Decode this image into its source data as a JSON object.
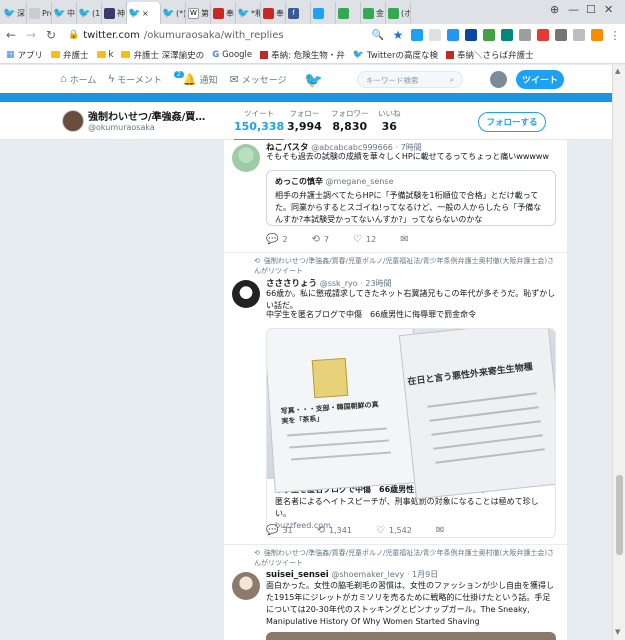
{
  "browser": {
    "tabs": [
      {
        "label": "深",
        "icon": "twitter-icon"
      },
      {
        "label": "Pro",
        "icon": "page-icon"
      },
      {
        "label": "中",
        "icon": "twitter-icon"
      },
      {
        "label": "(1)",
        "icon": "twitter-icon"
      },
      {
        "label": "神",
        "icon": "twitter-icon"
      },
      {
        "label": "×",
        "icon": "twitter-icon",
        "active": true
      },
      {
        "label": "(*)",
        "icon": "twitter-icon"
      },
      {
        "label": "第",
        "icon": "wikipedia-icon"
      },
      {
        "label": "奉",
        "icon": "red-icon"
      },
      {
        "label": "*和",
        "icon": "twitter-icon"
      },
      {
        "label": "奉",
        "icon": "red-icon"
      },
      {
        "label": "",
        "icon": "facebook-icon"
      },
      {
        "label": "",
        "icon": "twitter-icon"
      },
      {
        "label": "",
        "icon": "maps-icon"
      },
      {
        "label": "金",
        "icon": "maps-icon"
      },
      {
        "label": "(ホ",
        "icon": "maps-icon"
      }
    ],
    "url_host": "twitter.com",
    "url_path": "/okumuraosaka/with_replies",
    "bookmarks": [
      {
        "label": "アプリ",
        "icon": "apps-icon"
      },
      {
        "label": "弁護士",
        "icon": "folder-icon"
      },
      {
        "label": "k",
        "icon": "folder-icon"
      },
      {
        "label": "弁護士 深澤諭史の",
        "icon": "folder-icon"
      },
      {
        "label": "Google",
        "icon": "google-icon"
      },
      {
        "label": "奉納: 危険生物・弁",
        "icon": "red-icon"
      },
      {
        "label": "Twitterの高度な検",
        "icon": "twitter-icon"
      },
      {
        "label": "奉納＼さらば弁護士",
        "icon": "red-icon"
      }
    ]
  },
  "nav": {
    "home": "ホーム",
    "moments": "モーメント",
    "notifications": "通知",
    "notif_badge": "2",
    "messages": "メッセージ",
    "search_placeholder": "キーワード検索",
    "tweet_button": "ツイート"
  },
  "profile": {
    "name": "強制わいせつ/準強姦/買…",
    "handle": "@okumuraosaka",
    "stats": [
      {
        "label": "ツイート",
        "value": "150,338",
        "active": true
      },
      {
        "label": "フォロー",
        "value": "3,994"
      },
      {
        "label": "フォロワー",
        "value": "8,830"
      },
      {
        "label": "いいね",
        "value": "36"
      }
    ],
    "follow_button": "フォローする"
  },
  "tweets": [
    {
      "name": "ねこパスタ",
      "handle": "@abcabcabc999666",
      "time": "· 7時間",
      "text": "そもそも過去の試験の成績を華々しくHPに載せてるってちょっと痛いwwwww",
      "quote": {
        "name": "めっこの慎辛",
        "handle": "@megane_sense",
        "text": "相手の弁護士調べてたらHPに「予備試験を1桁順位で合格」とだけ載ってた。同業からするとスゴイね!ってなるけど、一般の人からしたら「予備なんすか?本試験受かってないんすか?」ってならないのかな"
      },
      "replies": "2",
      "retweets": "7",
      "likes": "12"
    },
    {
      "retweet_context": "強制わいせつ/準強姦/買春/児童ポルノ/児童福祉法/青少年条例弁護士奥村徹(大阪弁護士会)さんがリツイート",
      "name": "さささりょう",
      "handle": "@ssk_ryo",
      "time": "· 23時間",
      "text": "66歳か。私に懲戒請求してきたネット右翼諸兄もこの年代が多そうだ。恥ずかしい話だ。",
      "text2": "中学生を匿名ブログで中傷　66歳男性に侮辱罪で罰金命令",
      "card": {
        "title": "中学生を匿名ブログで中傷　66歳男性に侮辱罪で略式命令",
        "description": "匿名者によるヘイトスピーチが、刑事処罰の対象になることは極めて珍しい。",
        "domain": "buzzfeed.com",
        "image_headline": "在日と言う悪性外来寄生生物種",
        "image_caption": "写真・・・支部・韓国朝鮮の真実を「茶系」"
      },
      "replies": "31",
      "retweets": "1,341",
      "likes": "1,542"
    },
    {
      "retweet_context": "強制わいせつ/準強姦/買春/児童ポルノ/児童福祉法/青少年条例弁護士奥村徹(大阪弁護士会)さんがリツイート",
      "name": "suisei_sensei",
      "handle": "@shoemaker_levy",
      "time": "· 1月9日",
      "text": "面白かった。女性の脇毛剃毛の習慣は、女性のファッションが少し自由を獲得した1915年にジレットがカミソリを売るために戦略的に仕掛けたという話。手足については20-30年代のストッキングとピンナップガール。The Sneaky, Manipulative History Of Why Women Started Shaving"
    }
  ]
}
